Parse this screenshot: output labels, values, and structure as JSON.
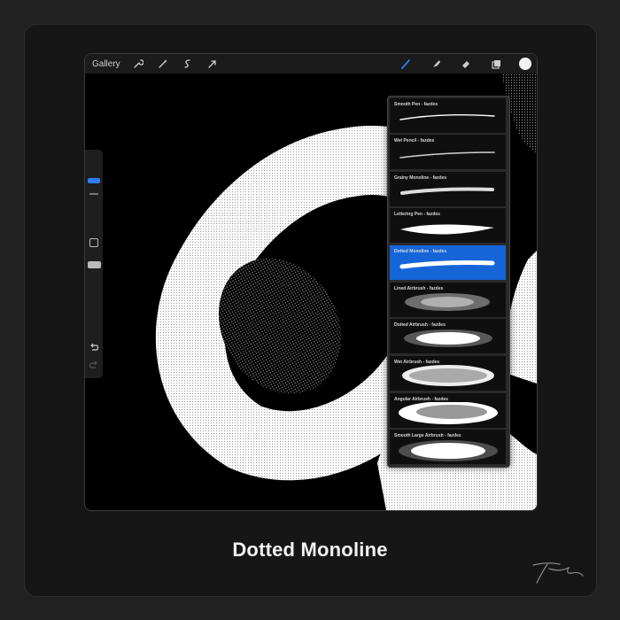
{
  "toolbar": {
    "gallery_label": "Gallery",
    "left_tools": [
      "wrench-icon",
      "magic-wand-icon",
      "selection-icon",
      "transform-arrow-icon"
    ],
    "right_tools": [
      "brush-icon",
      "smudge-icon",
      "eraser-icon",
      "layers-icon"
    ],
    "current_color": "#f2f2f2"
  },
  "brushes": [
    {
      "label": "Smooth Pen - fazdes",
      "selected": false
    },
    {
      "label": "Wet Pencil - fazdes",
      "selected": false
    },
    {
      "label": "Grainy Monoline - fazdes",
      "selected": false
    },
    {
      "label": "Lettering Pen - fazdes",
      "selected": false
    },
    {
      "label": "Dotted Monoline - fazdes",
      "selected": true
    },
    {
      "label": "Lined Airbrush - fazdes",
      "selected": false
    },
    {
      "label": "Dotted Airbrush - fazdes",
      "selected": false
    },
    {
      "label": "Wet Airbrush - fazdes",
      "selected": false
    },
    {
      "label": "Angular Airbrush - fazdes",
      "selected": false
    },
    {
      "label": "Smooth Large Airbrush - fazdes",
      "selected": false
    }
  ],
  "accent_color": "#1565d8",
  "caption": "Dotted Monoline"
}
